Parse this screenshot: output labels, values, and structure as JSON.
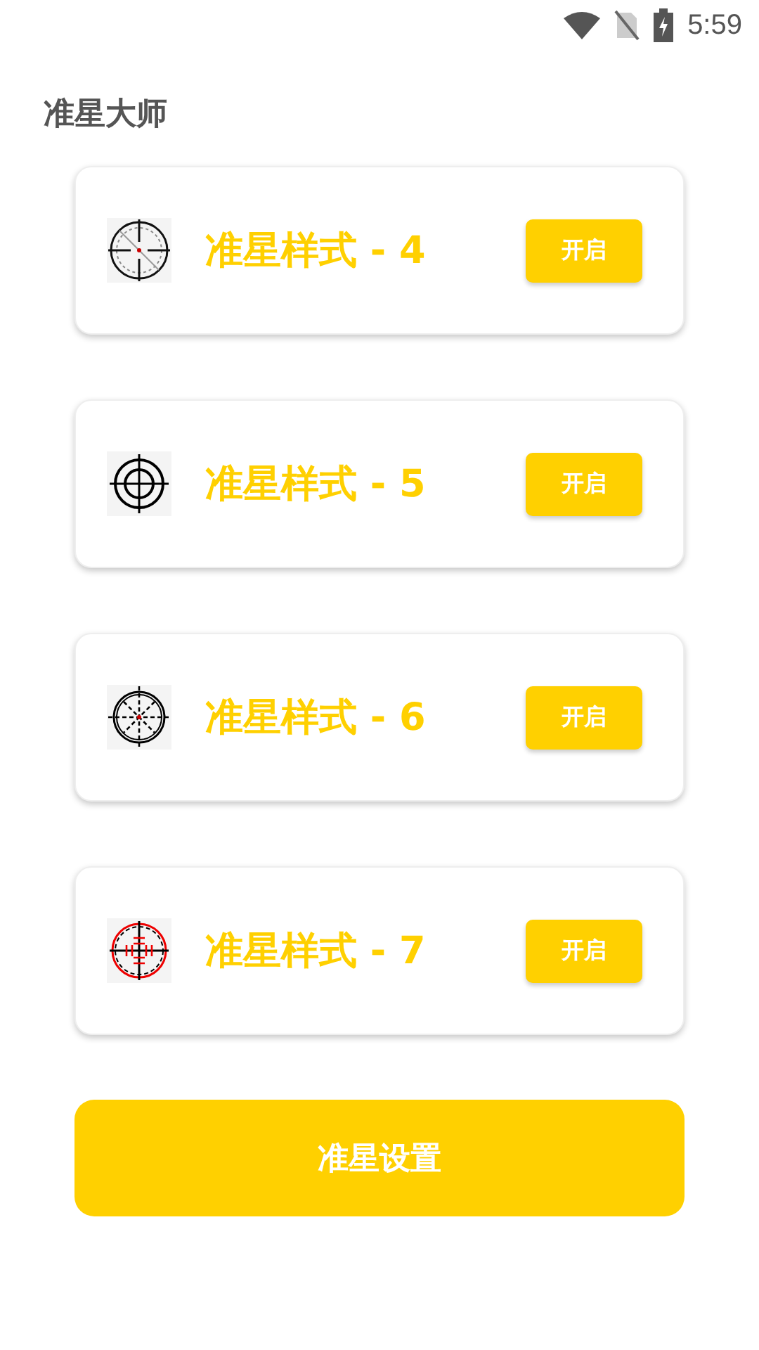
{
  "status_bar": {
    "time": "5:59"
  },
  "app_title": "准星大师",
  "crosshairs": [
    {
      "kind": "dashed",
      "name": "准星样式 - 4",
      "button": "开启"
    },
    {
      "kind": "rings",
      "name": "准星样式 - 5",
      "button": "开启"
    },
    {
      "kind": "spokes",
      "name": "准星样式 - 6",
      "button": "开启"
    },
    {
      "kind": "red",
      "name": "准星样式 - 7",
      "button": "开启"
    }
  ],
  "settings_button": "准星设置"
}
